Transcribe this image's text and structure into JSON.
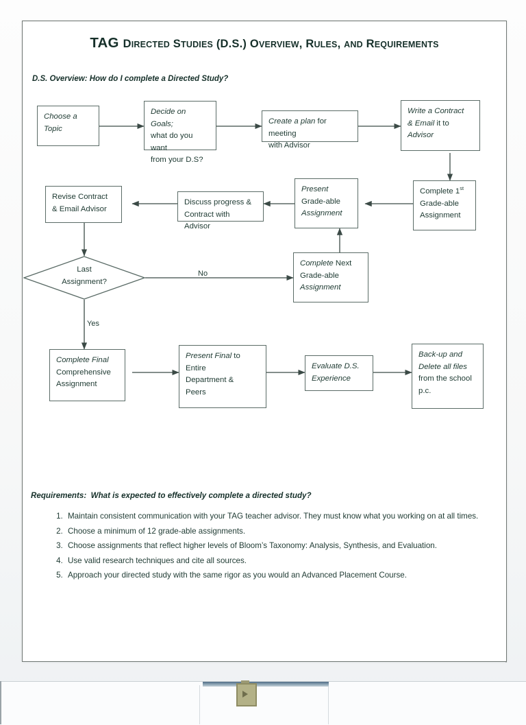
{
  "document": {
    "title_lead": "TAG",
    "title_rest": "Directed Studies (D.S.) Overview, Rules, and Requirements",
    "title_full": "TAG DIRECTED STUDIES (D.S.) OVERVIEW, RULES, AND REQUIREMENTS",
    "subheading": "D.S. Overview: How do I complete a Directed Study?"
  },
  "flowchart": {
    "nodes": [
      {
        "id": "choose-topic",
        "lines": [
          "Choose a",
          "Topic"
        ]
      },
      {
        "id": "decide-goals",
        "lines": [
          "Decide on Goals;",
          "what do you want",
          "from your D.S?"
        ]
      },
      {
        "id": "create-plan",
        "lines": [
          "Create a plan for meeting",
          "with Advisor"
        ]
      },
      {
        "id": "write-contract",
        "lines": [
          "Write a Contract",
          "& Email it to",
          "Advisor"
        ]
      },
      {
        "id": "complete-first",
        "lines": [
          "Complete 1st",
          "Grade-able",
          "Assignment"
        ]
      },
      {
        "id": "present-gradeable",
        "lines": [
          "Present",
          "Grade-able",
          "Assignment"
        ]
      },
      {
        "id": "discuss-progress",
        "lines": [
          "Discuss progress &",
          "Contract with Advisor"
        ]
      },
      {
        "id": "revise-contract",
        "lines": [
          "Revise Contract",
          "& Email Advisor"
        ]
      },
      {
        "id": "complete-next",
        "lines": [
          "Complete Next",
          "Grade-able",
          "Assignment"
        ]
      },
      {
        "id": "complete-final",
        "lines": [
          "Complete Final",
          "Comprehensive",
          "Assignment"
        ]
      },
      {
        "id": "present-final",
        "lines": [
          "Present Final to",
          "Entire",
          "Department &",
          "Peers"
        ]
      },
      {
        "id": "evaluate",
        "lines": [
          "Evaluate D.S.",
          "Experience"
        ]
      },
      {
        "id": "backup-delete",
        "lines": [
          "Back-up and",
          "Delete all files",
          "from the school",
          "p.c."
        ]
      }
    ],
    "decision": {
      "id": "last-assignment",
      "lines": [
        "Last",
        "Assignment?"
      ]
    },
    "edge_labels": {
      "no": "No",
      "yes": "Yes"
    },
    "colors": {
      "stroke": "#5a6b66",
      "text": "#1e3a32",
      "fill": "#ffffff"
    }
  },
  "requirements": {
    "heading_label": "Requirements",
    "heading_question": "What is expected to effectively complete a directed study?",
    "heading_full": "Requirements:  What is expected to effectively complete a directed study?",
    "items": [
      "Maintain consistent communication with your TAG teacher advisor.  They must know what you working on at all times.",
      "Choose a minimum of 12 grade-able assignments.",
      "Choose assignments that reflect higher levels of Bloom’s Taxonomy: Analysis, Synthesis, and Evaluation.",
      "Use valid research techniques and cite all sources.",
      "Approach your directed study with the same rigor as you would an Advanced Placement Course."
    ]
  },
  "scan_artifacts": {
    "clip_icon": "binder-clip-icon"
  }
}
